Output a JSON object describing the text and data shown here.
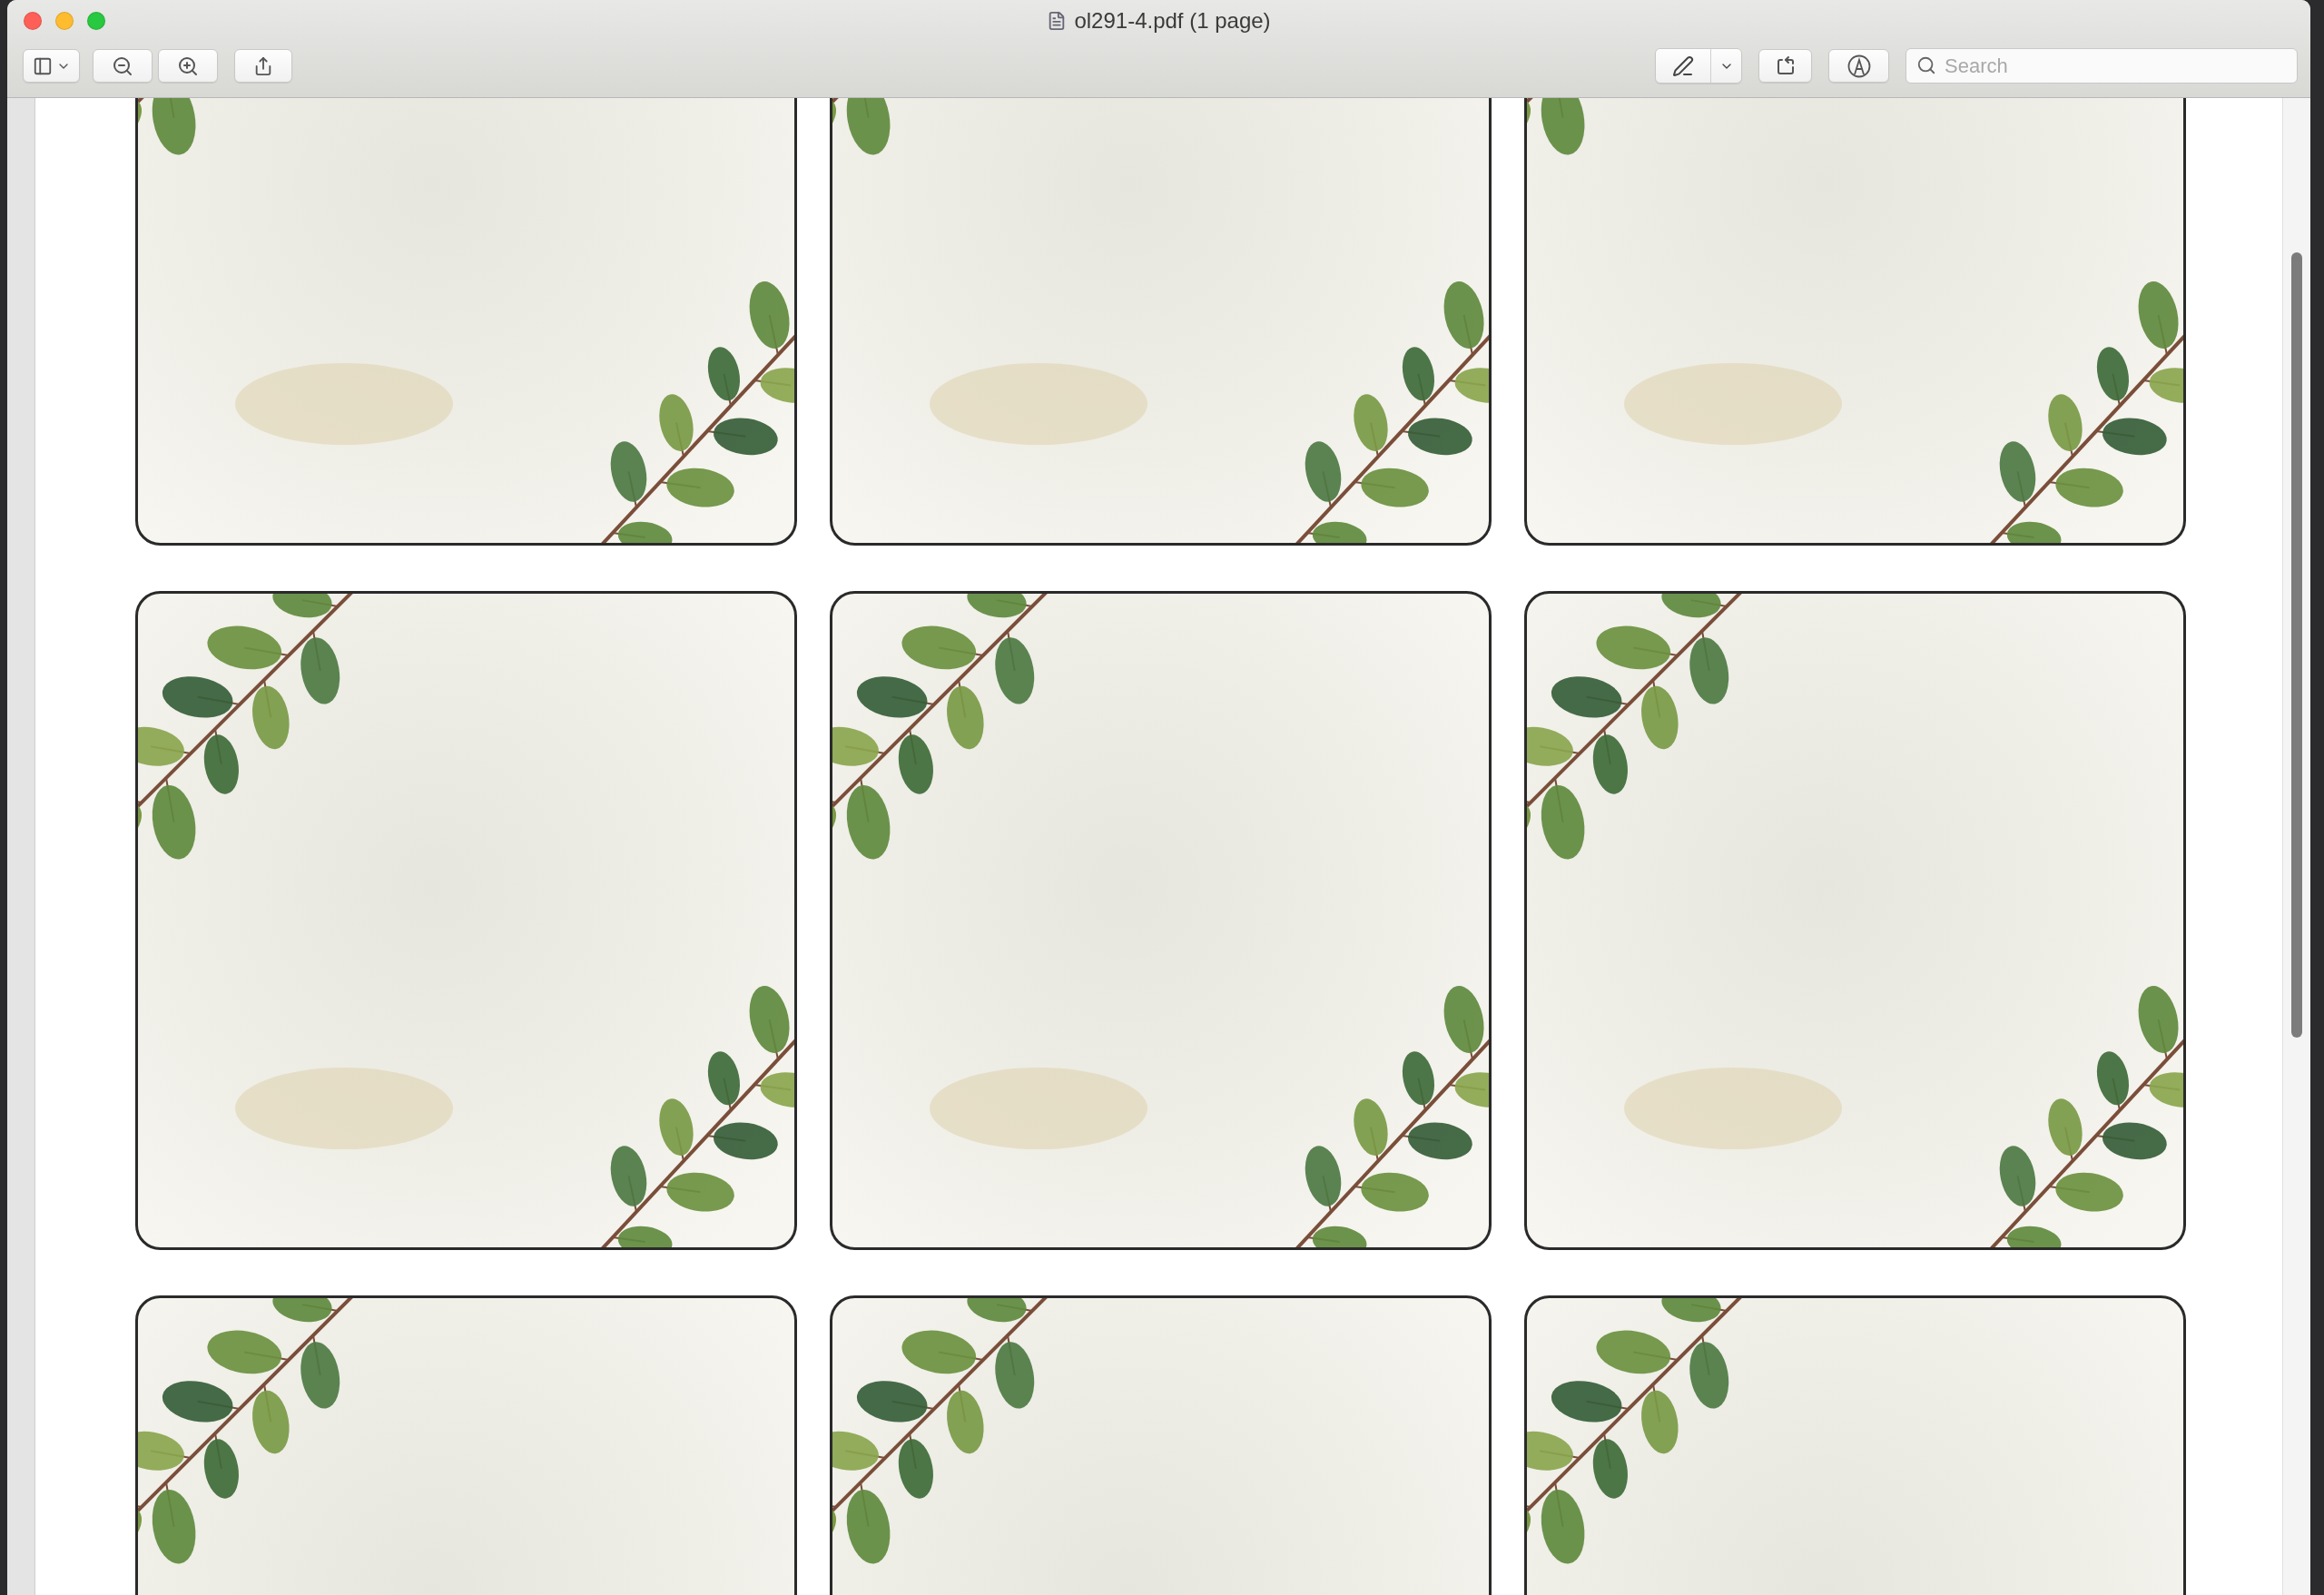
{
  "window": {
    "title": "ol291-4.pdf (1 page)"
  },
  "toolbar": {
    "search": {
      "placeholder": "Search"
    }
  },
  "document": {
    "cards": [
      {
        "kind": "leaf-card"
      },
      {
        "kind": "leaf-card"
      },
      {
        "kind": "leaf-card"
      },
      {
        "kind": "leaf-card"
      },
      {
        "kind": "leaf-card"
      },
      {
        "kind": "leaf-card"
      },
      {
        "kind": "leaf-card"
      },
      {
        "kind": "leaf-card"
      },
      {
        "kind": "leaf-card"
      }
    ]
  }
}
